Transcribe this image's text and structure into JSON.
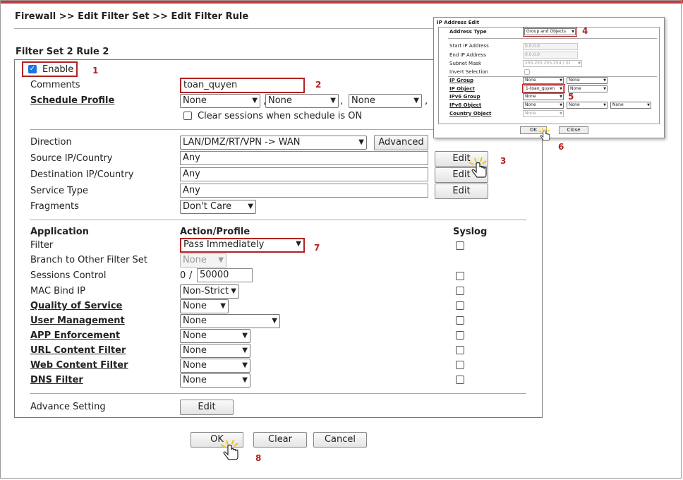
{
  "breadcrumb": "Firewall >> Edit Filter Set >> Edit Filter Rule",
  "section_title": "Filter Set 2 Rule 2",
  "enable_label": "Enable",
  "comments": {
    "label": "Comments",
    "value": "toan_quyen"
  },
  "schedule": {
    "label": "Schedule Profile",
    "options": [
      "None",
      "None",
      "None",
      "None"
    ],
    "clear_label": "Clear sessions when schedule is ON"
  },
  "direction": {
    "label": "Direction",
    "value": "LAN/DMZ/RT/VPN -> WAN",
    "advanced_label": "Advanced"
  },
  "source": {
    "label": "Source IP/Country",
    "value": "Any",
    "edit_label": "Edit"
  },
  "destination": {
    "label": "Destination IP/Country",
    "value": "Any",
    "edit_label": "Edit"
  },
  "service": {
    "label": "Service Type",
    "value": "Any",
    "edit_label": "Edit"
  },
  "fragments": {
    "label": "Fragments",
    "value": "Don't Care"
  },
  "headers": {
    "application": "Application",
    "action": "Action/Profile",
    "syslog": "Syslog"
  },
  "rows": {
    "filter": {
      "label": "Filter",
      "value": "Pass Immediately"
    },
    "branch": {
      "label": "Branch to Other Filter Set",
      "value": "None"
    },
    "sessions": {
      "label": "Sessions Control",
      "current": "0",
      "sep": "/",
      "max": "50000"
    },
    "mac": {
      "label": "MAC Bind IP",
      "value": "Non-Strict"
    },
    "qos": {
      "label": "Quality of Service",
      "value": "None"
    },
    "user": {
      "label": "User Management",
      "value": "None"
    },
    "app": {
      "label": "APP Enforcement",
      "value": "None"
    },
    "url": {
      "label": "URL Content Filter",
      "value": "None"
    },
    "web": {
      "label": "Web Content Filter",
      "value": "None"
    },
    "dns": {
      "label": "DNS Filter",
      "value": "None"
    }
  },
  "advanced_setting": {
    "label": "Advance Setting",
    "button": "Edit"
  },
  "buttons": {
    "ok": "OK",
    "clear": "Clear",
    "cancel": "Cancel"
  },
  "steps": [
    "1",
    "2",
    "3",
    "4",
    "5",
    "6",
    "7",
    "8"
  ],
  "popup": {
    "title": "IP Address Edit",
    "address_type_label": "Address Type",
    "address_type_value": "Group and Objects",
    "start_ip_label": "Start IP Address",
    "start_ip_value": "0.0.0.0",
    "end_ip_label": "End IP Address",
    "end_ip_value": "0.0.0.0",
    "subnet_label": "Subnet Mask",
    "subnet_value": "255.255.255.254 / 31",
    "invert_label": "Invert Selection",
    "ip_group_label": "IP Group",
    "ip_object_label": "IP Object",
    "ipv6_group_label": "IPv6 Group",
    "ipv6_object_label": "IPv6 Object",
    "country_label": "Country Object",
    "none": "None",
    "ip_object_value": "1-toan_quyen",
    "ok": "OK",
    "close": "Close"
  },
  "colors": {
    "accent_red": "#b22222",
    "top_bar": "#c43b3b",
    "checkbox_blue": "#1a73e8"
  }
}
